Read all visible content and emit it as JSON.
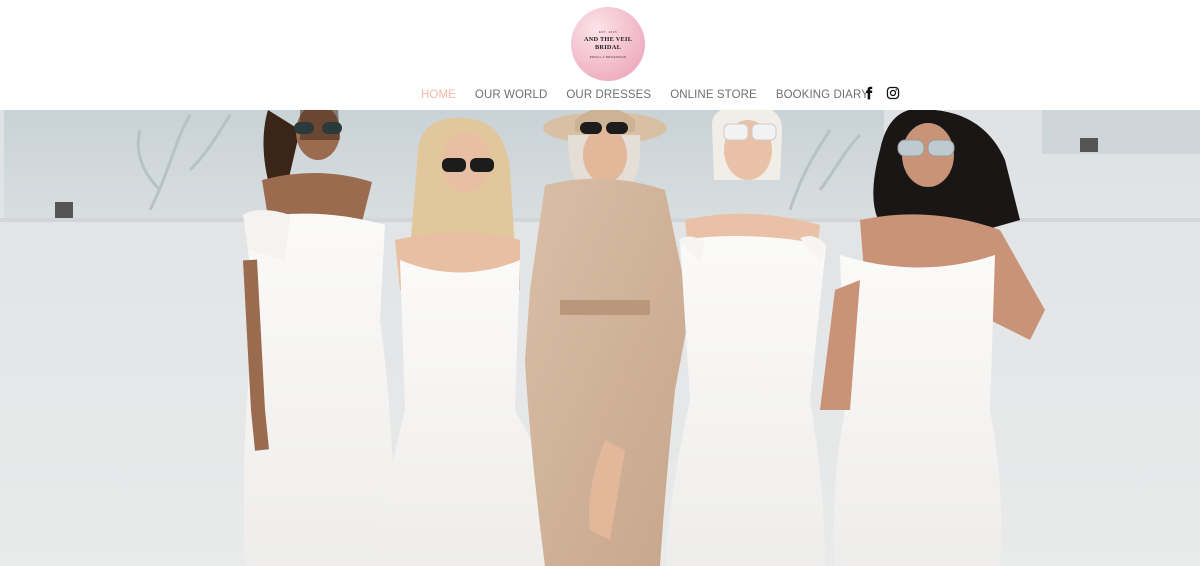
{
  "brand": {
    "est": "EST. 2015",
    "name": "AND THE VEIL BRIDAL",
    "tagline": "BRIDAL & BRIDESMAID"
  },
  "nav": {
    "items": [
      {
        "label": "HOME",
        "active": true
      },
      {
        "label": "OUR WORLD",
        "active": false
      },
      {
        "label": "OUR DRESSES",
        "active": false
      },
      {
        "label": "ONLINE STORE",
        "active": false
      },
      {
        "label": "BOOKING DIARY",
        "active": false
      }
    ]
  },
  "social": [
    {
      "icon": "facebook-icon"
    },
    {
      "icon": "instagram-icon"
    }
  ],
  "colors": {
    "nav_active": "#f2b8a8",
    "nav_text": "#6f6f6f",
    "logo_pink": "#f4c3d1"
  }
}
